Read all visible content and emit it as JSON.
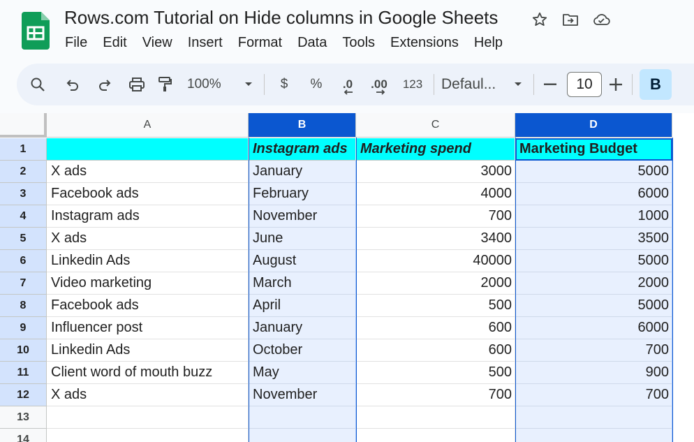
{
  "document": {
    "title": "Rows.com Tutorial on Hide columns in Google Sheets"
  },
  "menu": [
    "File",
    "Edit",
    "View",
    "Insert",
    "Format",
    "Data",
    "Tools",
    "Extensions",
    "Help"
  ],
  "toolbar": {
    "zoom": "100%",
    "currency_symbol": "$",
    "percent_symbol": "%",
    "decrease_decimal": ".0",
    "increase_decimal": ".00",
    "more_formats": "123",
    "font_family": "Defaul...",
    "font_size": "10",
    "bold": "B"
  },
  "sheet": {
    "columns": [
      "A",
      "B",
      "C",
      "D"
    ],
    "rows": [
      "1",
      "2",
      "3",
      "4",
      "5",
      "6",
      "7",
      "8",
      "9",
      "10",
      "11",
      "12",
      "13",
      "14"
    ],
    "selected_columns": [
      "B",
      "D"
    ],
    "active_cell": "D1",
    "header_row": [
      "",
      "Instagram ads",
      "Marketing spend",
      "Marketing Budget"
    ],
    "data_rows": [
      [
        "X ads",
        "January",
        "3000",
        "5000"
      ],
      [
        "Facebook ads",
        "February",
        "4000",
        "6000"
      ],
      [
        "Instagram ads",
        "November",
        "700",
        "1000"
      ],
      [
        "X ads",
        "June",
        "3400",
        "3500"
      ],
      [
        "Linkedin Ads",
        "August",
        "40000",
        "5000"
      ],
      [
        "Video marketing",
        "March",
        "2000",
        "2000"
      ],
      [
        "Facebook ads",
        "April",
        "500",
        "5000"
      ],
      [
        "Influencer post",
        "January",
        "600",
        "6000"
      ],
      [
        "Linkedin Ads",
        "October",
        "600",
        "700"
      ],
      [
        "Client word of mouth buzz",
        "May",
        "500",
        "900"
      ],
      [
        "X ads",
        "November",
        "700",
        "700"
      ]
    ]
  },
  "colors": {
    "accent": "#0b57d0",
    "header_fill": "#00ffff",
    "selection": "#e8f0fe",
    "logo": "#0f9d58"
  }
}
